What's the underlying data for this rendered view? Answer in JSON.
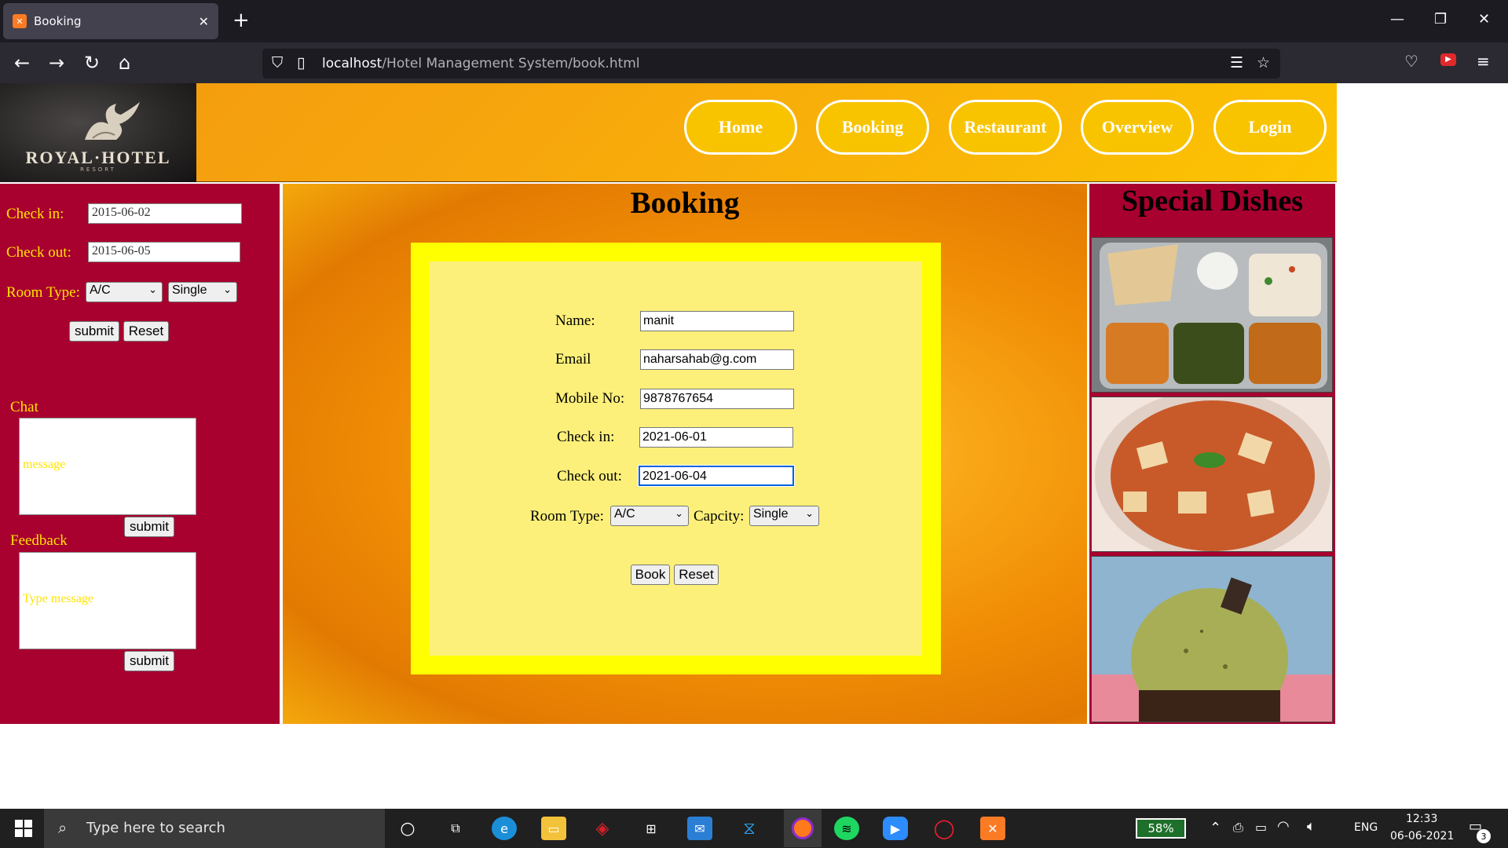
{
  "browser": {
    "tab_title": "Booking",
    "tab_favicon": "xampp-icon",
    "url_host": "localhost",
    "url_path": "/Hotel Management System/book.html"
  },
  "header": {
    "logo_text": "ROYAL·HOTEL",
    "logo_sub": "RESORT",
    "nav": [
      "Home",
      "Booking",
      "Restaurant",
      "Overview",
      "Login"
    ]
  },
  "sidebar": {
    "checkin_label": "Check in:",
    "checkin_value": "2015-06-02",
    "checkout_label": "Check out:",
    "checkout_value": "2015-06-05",
    "roomtype_label": "Room Type:",
    "roomtype_value": "A/C",
    "capacity_value": "Single",
    "submit_label": "submit",
    "reset_label": "Reset",
    "chat_label": "Chat",
    "chat_placeholder": "message",
    "chat_submit": "submit",
    "feedback_label": "Feedback",
    "feedback_placeholder": "Type message",
    "feedback_submit": "submit"
  },
  "main": {
    "title": "Booking",
    "form": {
      "name_label": "Name:",
      "name_value": "manit",
      "email_label": "Email",
      "email_value": "naharsahab@g.com",
      "mobile_label": "Mobile No:",
      "mobile_value": "9878767654",
      "checkin_label": "Check in:",
      "checkin_value": "2021-06-01",
      "checkout_label": "Check out:",
      "checkout_value": "2021-06-04",
      "roomtype_label": "Room Type:",
      "roomtype_value": "A/C",
      "capacity_label": "Capcity:",
      "capacity_value": "Single",
      "book_label": "Book",
      "reset_label": "Reset"
    }
  },
  "right": {
    "title": "Special Dishes"
  },
  "taskbar": {
    "search_placeholder": "Type here to search",
    "battery": "58%",
    "language": "ENG",
    "time": "12:33",
    "date": "06-06-2021",
    "notifications": "3"
  },
  "colors": {
    "sidebar_bg": "#a8002f",
    "sidebar_text": "#ffe400",
    "form_frame": "#ffff00",
    "form_inner": "#fdf07a",
    "nav_pill": "#f8c400"
  }
}
